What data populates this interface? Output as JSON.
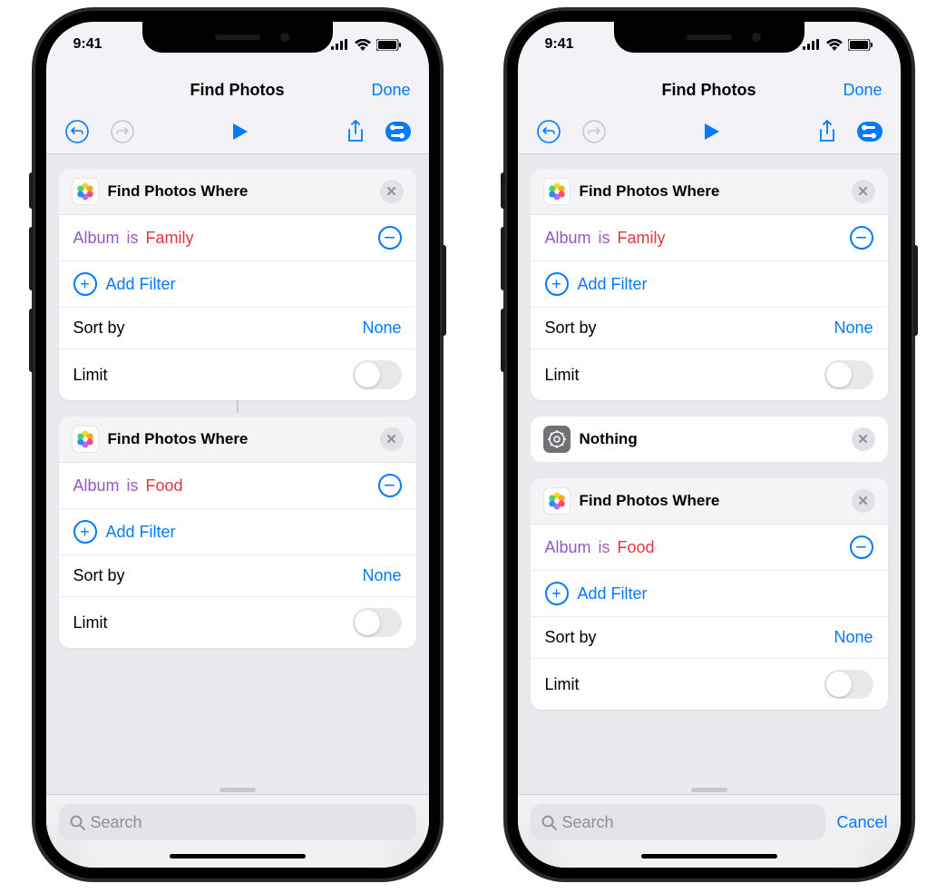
{
  "status": {
    "time": "9:41"
  },
  "nav": {
    "title": "Find Photos",
    "done": "Done"
  },
  "labels": {
    "add_filter": "Add Filter",
    "sort_by": "Sort by",
    "limit": "Limit"
  },
  "search": {
    "placeholder": "Search",
    "cancel": "Cancel"
  },
  "left": {
    "cards": [
      {
        "title": "Find Photos Where",
        "filter": {
          "field": "Album",
          "op": "is",
          "value": "Family"
        },
        "sort_value": "None"
      },
      {
        "title": "Find Photos Where",
        "filter": {
          "field": "Album",
          "op": "is",
          "value": "Food"
        },
        "sort_value": "None"
      }
    ]
  },
  "right": {
    "cards": [
      {
        "title": "Find Photos Where",
        "filter": {
          "field": "Album",
          "op": "is",
          "value": "Family"
        },
        "sort_value": "None"
      },
      {
        "title": "Find Photos Where",
        "filter": {
          "field": "Album",
          "op": "is",
          "value": "Food"
        },
        "sort_value": "None"
      }
    ],
    "nothing_card": {
      "title": "Nothing"
    }
  }
}
